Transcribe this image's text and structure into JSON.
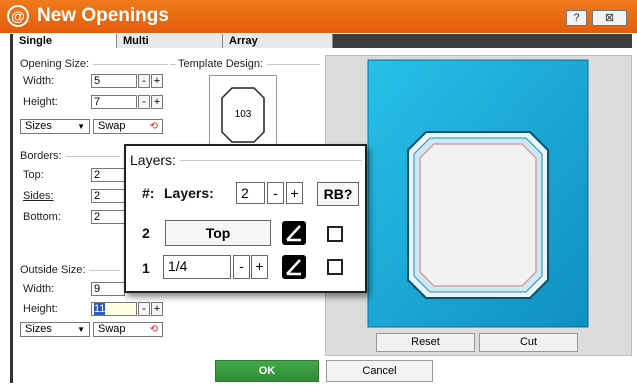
{
  "window": {
    "logo_char": "@",
    "title": "New Openings",
    "help_label": "?",
    "close_label": "⊠",
    "accent_color": "#ea6a14"
  },
  "tabs": [
    {
      "label": "Single",
      "active": true
    },
    {
      "label": "Multi",
      "active": false
    },
    {
      "label": "Array",
      "active": false
    }
  ],
  "opening_size": {
    "group_label": "Opening Size:",
    "width_label": "Width:",
    "width_value": "5",
    "height_label": "Height:",
    "height_value": "7",
    "sizes_label": "Sizes",
    "swap_label": "Swap"
  },
  "template": {
    "group_label": "Template Design:",
    "number": "103"
  },
  "borders": {
    "group_label": "Borders:",
    "top_label": "Top:",
    "top_value": "2",
    "sides_label": "Sides:",
    "sides_value": "2",
    "bottom_label": "Bottom:",
    "bottom_value": "2"
  },
  "outside_size": {
    "group_label": "Outside Size:",
    "width_label": "Width:",
    "width_value": "9",
    "height_label": "Height:",
    "height_value": "11",
    "sizes_label": "Sizes",
    "swap_label": "Swap"
  },
  "stepper": {
    "minus": "-",
    "plus": "+"
  },
  "layers_popup": {
    "title": "Layers:",
    "hash_label": "#:",
    "layers_label": "Layers:",
    "layers_value": "2",
    "rb_label": "RB?",
    "rows": [
      {
        "num": "2",
        "value": "Top"
      },
      {
        "num": "1",
        "value": "1/4"
      }
    ]
  },
  "preview": {
    "reset_label": "Reset",
    "cut_label": "Cut",
    "mat_color": "#19a9d3",
    "background_color": "#dcdcdc"
  },
  "footer": {
    "ok_label": "OK",
    "cancel_label": "Cancel",
    "ok_color": "#3a9b40"
  }
}
